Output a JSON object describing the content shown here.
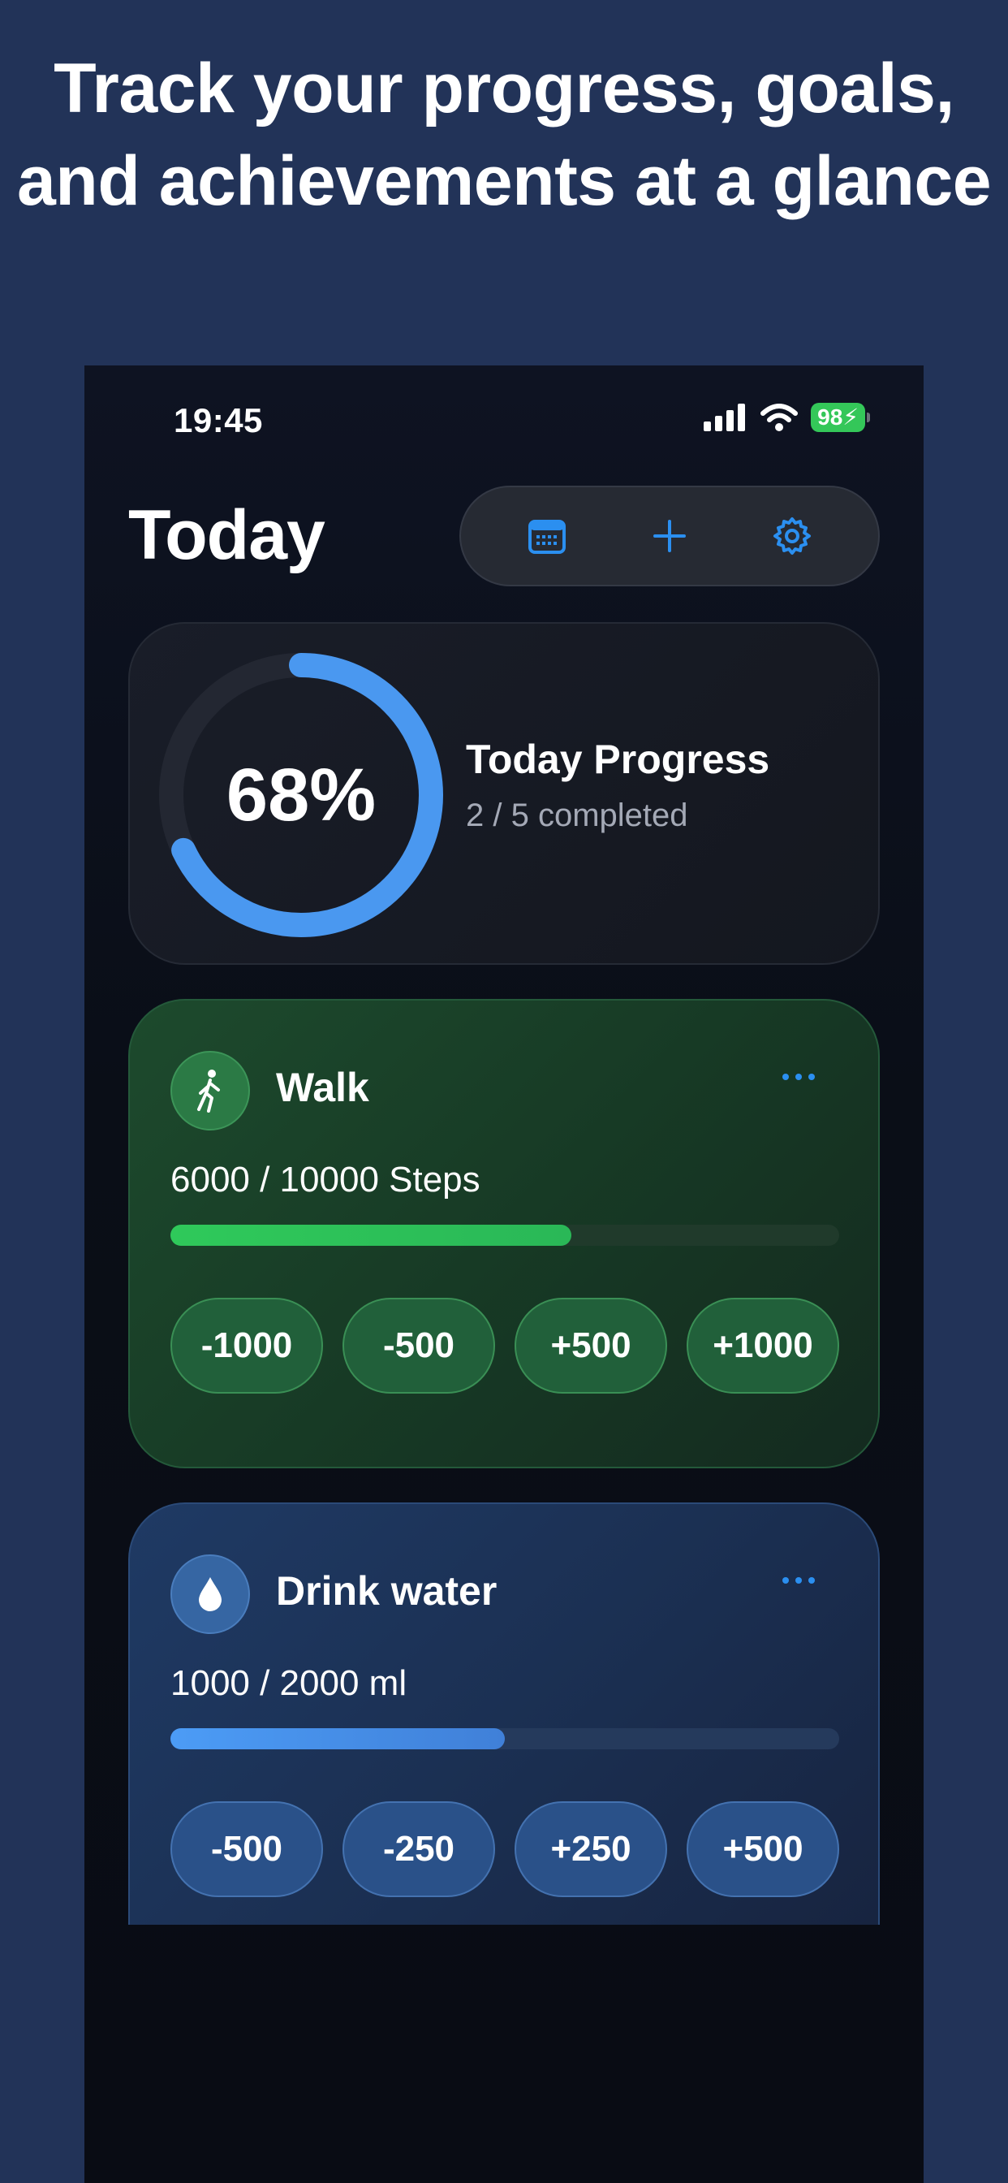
{
  "headline": {
    "line1": "Track your progress, goals,",
    "line2": "and achievements at a glance"
  },
  "status_bar": {
    "time": "19:45",
    "battery": "98",
    "icons": [
      "cellular-signal-icon",
      "wifi-icon",
      "battery-charging-icon"
    ]
  },
  "header": {
    "title": "Today",
    "toolbar": [
      "calendar-icon",
      "plus-icon",
      "gear-icon"
    ]
  },
  "progress": {
    "percent_label": "68%",
    "fraction": 0.68,
    "title": "Today Progress",
    "subtitle": "2 / 5 completed"
  },
  "habits": [
    {
      "name": "Walk",
      "icon": "walking-person-icon",
      "count_text": "6000 / 10000 Steps",
      "progress": 0.6,
      "buttons": [
        "-1000",
        "-500",
        "+500",
        "+1000"
      ]
    },
    {
      "name": "Drink water",
      "icon": "water-drop-icon",
      "count_text": "1000 / 2000 ml",
      "progress": 0.5,
      "buttons": [
        "-500",
        "-250",
        "+250",
        "+500"
      ]
    }
  ],
  "colors": {
    "accent": "#2b8ff0",
    "walk_green": "#2fc95a",
    "water_blue": "#4c9cf6",
    "ring_blue": "#4a98f0"
  }
}
